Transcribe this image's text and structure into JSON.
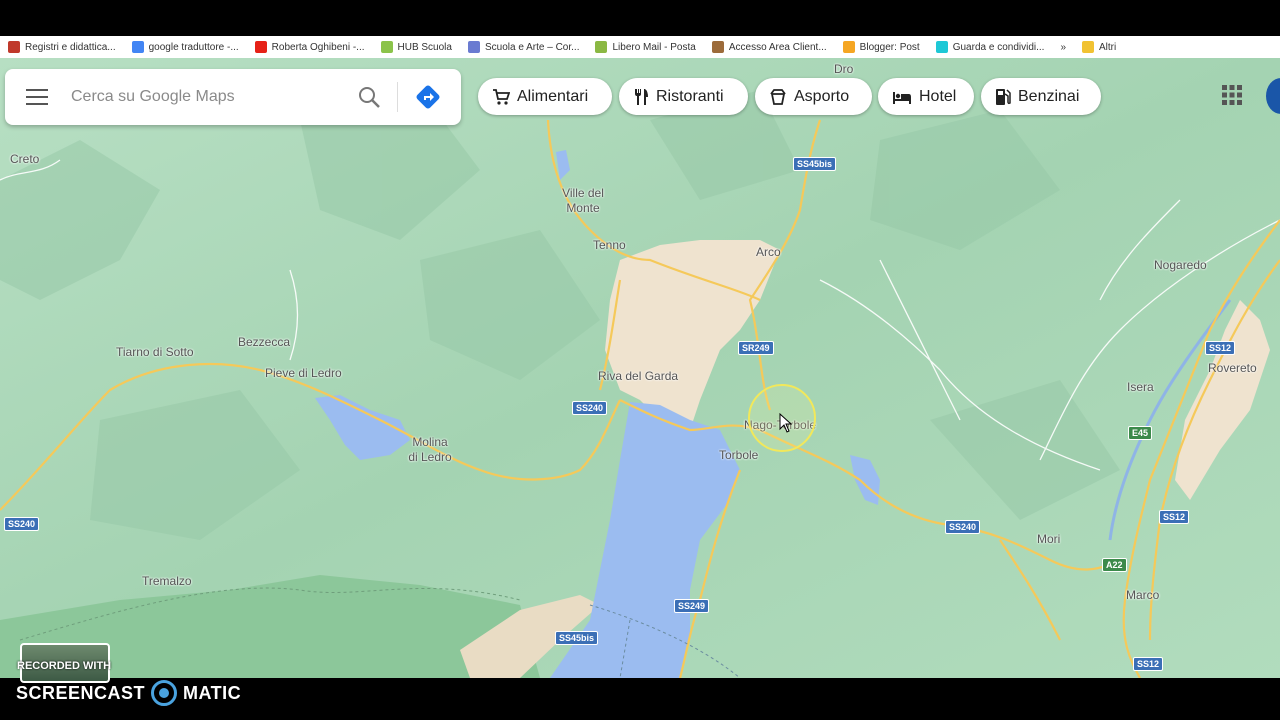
{
  "bookmarks": [
    {
      "label": "Registri e didattica...",
      "icon": "red-square-icon",
      "color": "#c0392b"
    },
    {
      "label": "google traduttore -...",
      "icon": "google-g-icon",
      "color": "#4285f4"
    },
    {
      "label": "Roberta Oghibeni -...",
      "icon": "youtube-icon",
      "color": "#e62117"
    },
    {
      "label": "HUB Scuola",
      "icon": "hub-icon",
      "color": "#8bc34a"
    },
    {
      "label": "Scuola e Arte – Cor...",
      "icon": "scuola-icon",
      "color": "#6a7bd1"
    },
    {
      "label": "Libero Mail - Posta",
      "icon": "libero-icon",
      "color": "#8bb843"
    },
    {
      "label": "Accesso Area Client...",
      "icon": "building-icon",
      "color": "#9c6b3a"
    },
    {
      "label": "Blogger: Post",
      "icon": "blogger-icon",
      "color": "#f5a623"
    },
    {
      "label": "Guarda e condividi...",
      "icon": "share-icon",
      "color": "#1ec8d6"
    },
    {
      "label": "»",
      "icon": "",
      "color": "#555"
    },
    {
      "label": "Altri",
      "icon": "folder-icon",
      "color": "#f1c232"
    }
  ],
  "search": {
    "placeholder": "Cerca su Google Maps",
    "menu_icon": "menu-icon",
    "search_icon": "search-icon",
    "directions_icon": "directions-icon"
  },
  "chips": [
    {
      "label": "Alimentari",
      "icon": "cart-icon"
    },
    {
      "label": "Ristoranti",
      "icon": "fork-knife-icon"
    },
    {
      "label": "Asporto",
      "icon": "takeout-icon"
    },
    {
      "label": "Hotel",
      "icon": "bed-icon"
    },
    {
      "label": "Benzinai",
      "icon": "gas-pump-icon"
    }
  ],
  "apps_icon": "apps-grid-icon",
  "map": {
    "places": {
      "dro": "Dro",
      "creto": "Creto",
      "ville_del_monte_1": "Ville del",
      "ville_del_monte_2": "Monte",
      "tenno": "Tenno",
      "arco": "Arco",
      "nogaredo": "Nogaredo",
      "tiarno": "Tiarno di Sotto",
      "bezzecca": "Bezzecca",
      "pieve": "Pieve di Ledro",
      "riva": "Riva del Garda",
      "isera": "Isera",
      "rovereto": "Rovereto",
      "molina_1": "Molina",
      "molina_2": "di Ledro",
      "nago": "Nago-Torbole",
      "torbole": "Torbole",
      "mori": "Mori",
      "tremalzo": "Tremalzo",
      "marco": "Marco"
    },
    "roads": {
      "ss45bis_top": "SS45bis",
      "sr249": "SR249",
      "ss12_top": "SS12",
      "ss240_riva": "SS240",
      "e45": "E45",
      "ss240_west": "SS240",
      "ss240_east": "SS240",
      "ss12_mid": "SS12",
      "a22": "A22",
      "ss249": "SS249",
      "ss45bis_bottom": "SS45bis",
      "ss12_bottom": "SS12"
    },
    "colors": {
      "terrain": "#a9d7b7",
      "water": "#9bbcf0",
      "urban": "#efe3cf",
      "road": "#f5c95a",
      "shield": "#3b6fb6"
    }
  },
  "overlay": {
    "recorded_with": "RECORDED WITH",
    "brand_left": "SCREENCAST",
    "brand_right": "MATIC"
  }
}
